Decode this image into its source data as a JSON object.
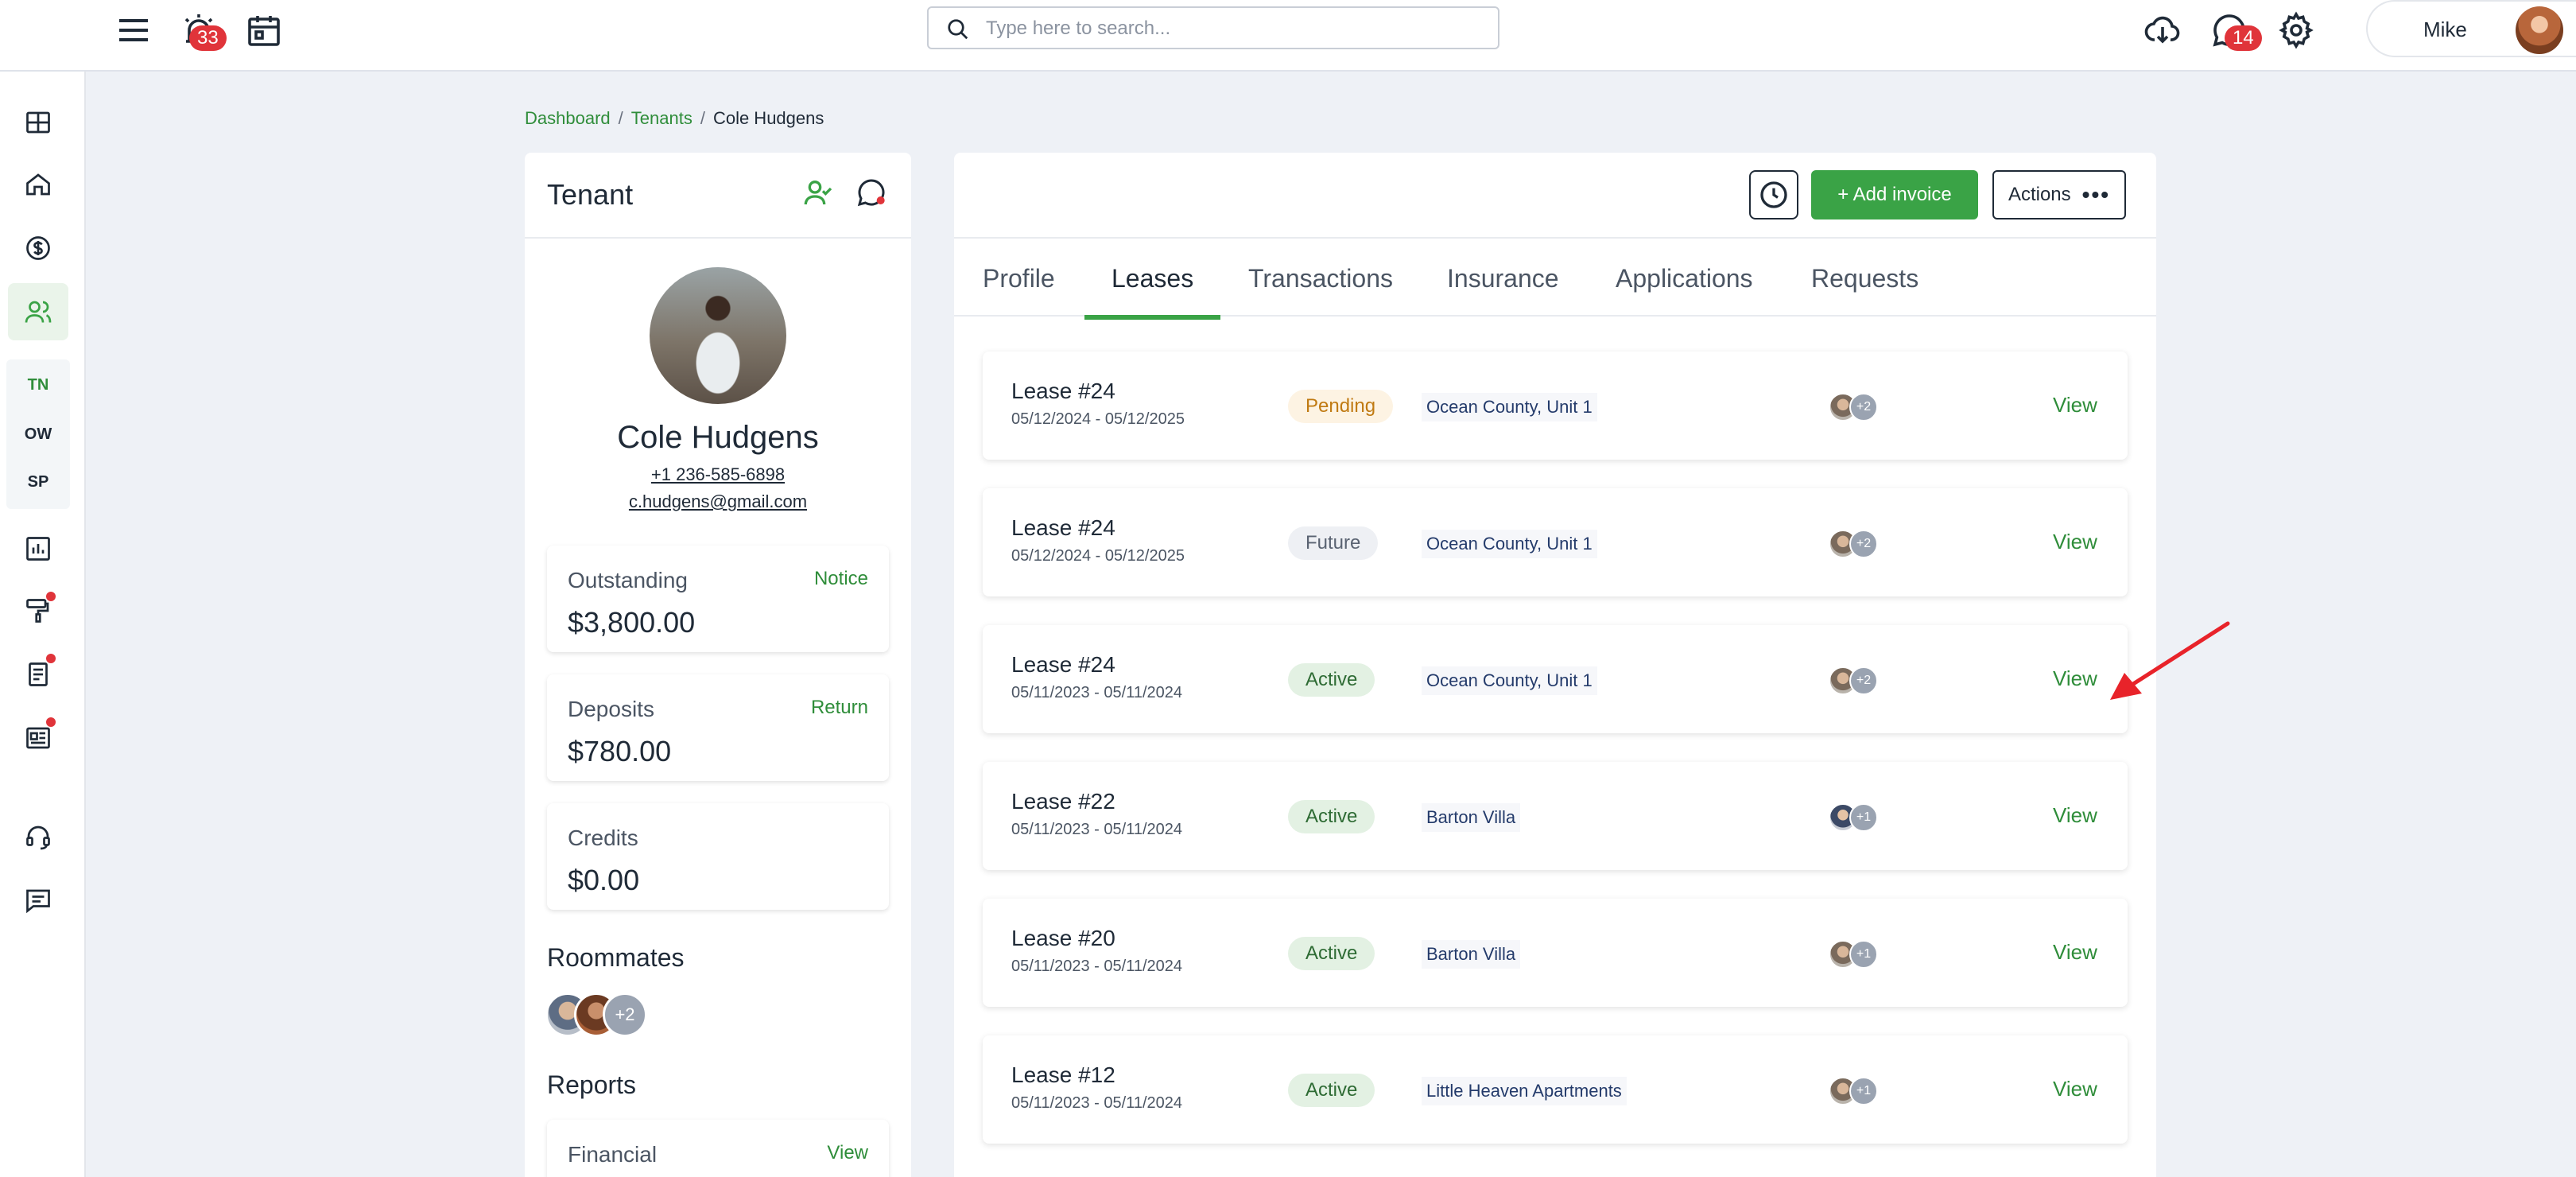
{
  "topbar": {
    "alarm_count": "33",
    "messages_count": "14",
    "search_placeholder": "Type here to search...",
    "user_name": "Mike"
  },
  "sidebar": {
    "labels": [
      "TN",
      "OW",
      "SP"
    ]
  },
  "breadcrumb": {
    "items": [
      "Dashboard",
      "Tenants",
      "Cole Hudgens"
    ],
    "separator": "/"
  },
  "tenant": {
    "card_title": "Tenant",
    "name": "Cole Hudgens",
    "phone": "+1 236-585-6898",
    "email": "c.hudgens@gmail.com",
    "outstanding": {
      "label": "Outstanding",
      "action": "Notice",
      "value": "$3,800.00"
    },
    "deposits": {
      "label": "Deposits",
      "action": "Return",
      "value": "$780.00"
    },
    "credits": {
      "label": "Credits",
      "value": "$0.00"
    },
    "roommates_title": "Roommates",
    "roommates_more": "+2",
    "reports_title": "Reports",
    "report_financial": {
      "label": "Financial",
      "action": "View"
    }
  },
  "main": {
    "add_invoice_label": "+ Add invoice",
    "actions_label": "Actions",
    "tabs": [
      "Profile",
      "Leases",
      "Transactions",
      "Insurance",
      "Applications",
      "Requests"
    ],
    "active_tab": "Leases",
    "leases": [
      {
        "title": "Lease #24",
        "dates": "05/12/2024 - 05/12/2025",
        "status": "Pending",
        "property": "Ocean County, Unit 1",
        "more": "+2",
        "action": "View"
      },
      {
        "title": "Lease #24",
        "dates": "05/12/2024 - 05/12/2025",
        "status": "Future",
        "property": "Ocean County, Unit 1",
        "more": "+2",
        "action": "View"
      },
      {
        "title": "Lease #24",
        "dates": "05/11/2023 - 05/11/2024",
        "status": "Active",
        "property": "Ocean County, Unit 1",
        "more": "+2",
        "action": "View"
      },
      {
        "title": "Lease #22",
        "dates": "05/11/2023 - 05/11/2024",
        "status": "Active",
        "property": "Barton Villa",
        "more": "+1",
        "action": "View"
      },
      {
        "title": "Lease #20",
        "dates": "05/11/2023 - 05/11/2024",
        "status": "Active",
        "property": "Barton Villa",
        "more": "+1",
        "action": "View"
      },
      {
        "title": "Lease #12",
        "dates": "05/11/2023 - 05/11/2024",
        "status": "Active",
        "property": "Little Heaven Apartments",
        "more": "+1",
        "action": "View"
      }
    ]
  },
  "colors": {
    "accent": "#3aa346",
    "badge": "#e0343a",
    "annotation_arrow": "#e8232a"
  }
}
